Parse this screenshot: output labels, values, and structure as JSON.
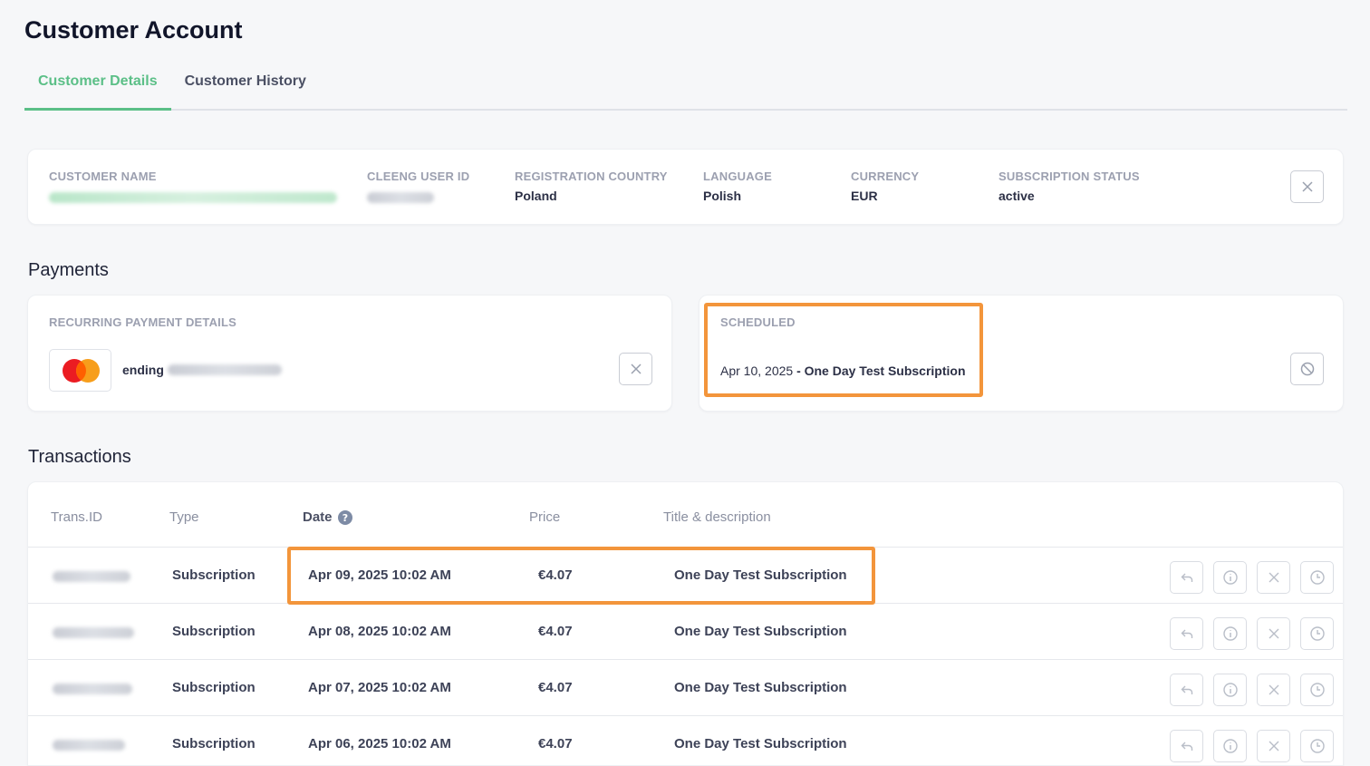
{
  "page": {
    "title": "Customer Account"
  },
  "tabs": [
    {
      "label": "Customer Details",
      "active": true
    },
    {
      "label": "Customer History",
      "active": false
    }
  ],
  "customer": {
    "fields": [
      {
        "label": "CUSTOMER NAME",
        "value": "",
        "redacted": true
      },
      {
        "label": "CLEENG USER ID",
        "value": "",
        "redacted": true
      },
      {
        "label": "REGISTRATION COUNTRY",
        "value": "Poland"
      },
      {
        "label": "LANGUAGE",
        "value": "Polish"
      },
      {
        "label": "CURRENCY",
        "value": "EUR"
      },
      {
        "label": "SUBSCRIPTION STATUS",
        "value": "active"
      }
    ],
    "close_icon": "close-icon"
  },
  "payments": {
    "title": "Payments",
    "recurring": {
      "label": "RECURRING PAYMENT DETAILS",
      "card_brand_icon": "mastercard-icon",
      "ending_label": "ending"
    },
    "scheduled": {
      "label": "SCHEDULED",
      "date": "Apr 10, 2025",
      "title": "- One Day Test Subscription",
      "cancel_icon": "block-icon"
    }
  },
  "transactions": {
    "title": "Transactions",
    "columns": [
      "Trans.ID",
      "Type",
      "Date",
      "Price",
      "Title & description"
    ],
    "date_help_icon": "help-icon",
    "rows": [
      {
        "type": "Subscription",
        "date": "Apr 09, 2025 10:02 AM",
        "price": "€4.07",
        "title": "One Day Test Subscription"
      },
      {
        "type": "Subscription",
        "date": "Apr 08, 2025 10:02 AM",
        "price": "€4.07",
        "title": "One Day Test Subscription"
      },
      {
        "type": "Subscription",
        "date": "Apr 07, 2025 10:02 AM",
        "price": "€4.07",
        "title": "One Day Test Subscription"
      },
      {
        "type": "Subscription",
        "date": "Apr 06, 2025 10:02 AM",
        "price": "€4.07",
        "title": "One Day Test Subscription"
      }
    ],
    "row_action_icons": [
      "refund-icon",
      "info-icon",
      "close-icon",
      "clock-icon"
    ]
  },
  "colors": {
    "accent": "#5bbf87",
    "highlight": "#f3953b",
    "text_dark": "#11152a",
    "label_grey": "#9ca0b0"
  }
}
